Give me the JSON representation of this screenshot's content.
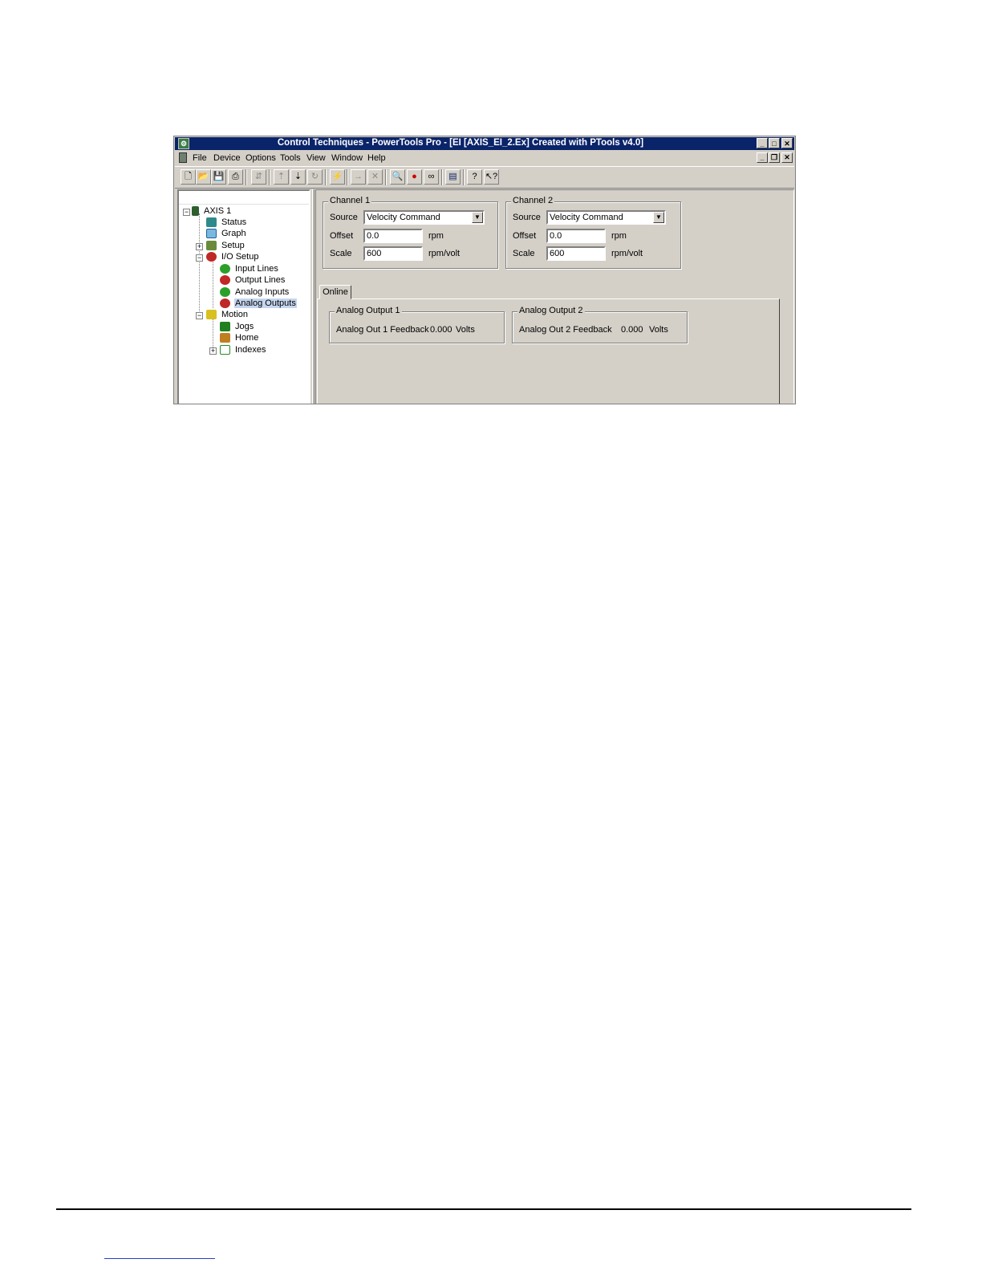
{
  "window": {
    "title": "Control Techniques - PowerTools Pro - [EI  [AXIS_EI_2.Ex] Created with PTools v4.0]",
    "app_icon": "powertools-app-icon"
  },
  "menu": {
    "items": [
      "File",
      "Device",
      "Options",
      "Tools",
      "View",
      "Window",
      "Help"
    ]
  },
  "toolbar": {
    "buttons": [
      "new-icon",
      "open-icon",
      "save-icon",
      "print-icon",
      "disabled-icon",
      "upload-icon",
      "download-icon",
      "refresh-icon",
      "connect-icon",
      "send-icon",
      "cancel-icon",
      "zoom-icon",
      "stop-icon",
      "glasses-icon",
      "window-icon",
      "help-icon",
      "context-help-icon"
    ]
  },
  "tree": {
    "root": "AXIS 1",
    "items": {
      "status": "Status",
      "graph": "Graph",
      "setup": "Setup",
      "io_setup": "I/O Setup",
      "input_lines": "Input Lines",
      "output_lines": "Output Lines",
      "analog_inputs": "Analog Inputs",
      "analog_outputs": "Analog Outputs",
      "motion": "Motion",
      "jogs": "Jogs",
      "home": "Home",
      "indexes": "Indexes"
    },
    "selected": "Analog Outputs"
  },
  "channel1": {
    "title": "Channel 1",
    "source_label": "Source",
    "source_value": "Velocity Command",
    "offset_label": "Offset",
    "offset_value": "0.0",
    "offset_unit": "rpm",
    "scale_label": "Scale",
    "scale_value": "600",
    "scale_unit": "rpm/volt"
  },
  "channel2": {
    "title": "Channel 2",
    "source_label": "Source",
    "source_value": "Velocity Command",
    "offset_label": "Offset",
    "offset_value": "0.0",
    "offset_unit": "rpm",
    "scale_label": "Scale",
    "scale_value": "600",
    "scale_unit": "rpm/volt"
  },
  "online_tab": {
    "label": "Online",
    "output1": {
      "title": "Analog Output 1",
      "label": "Analog Out 1 Feedback",
      "value": "0.000",
      "unit": "Volts"
    },
    "output2": {
      "title": "Analog Output 2",
      "label": "Analog Out 2 Feedback",
      "value": "0.000",
      "unit": "Volts"
    }
  },
  "colors": {
    "titlebar": "#0a246a",
    "face": "#d4d0c8",
    "selection": "#c5d5ee"
  }
}
